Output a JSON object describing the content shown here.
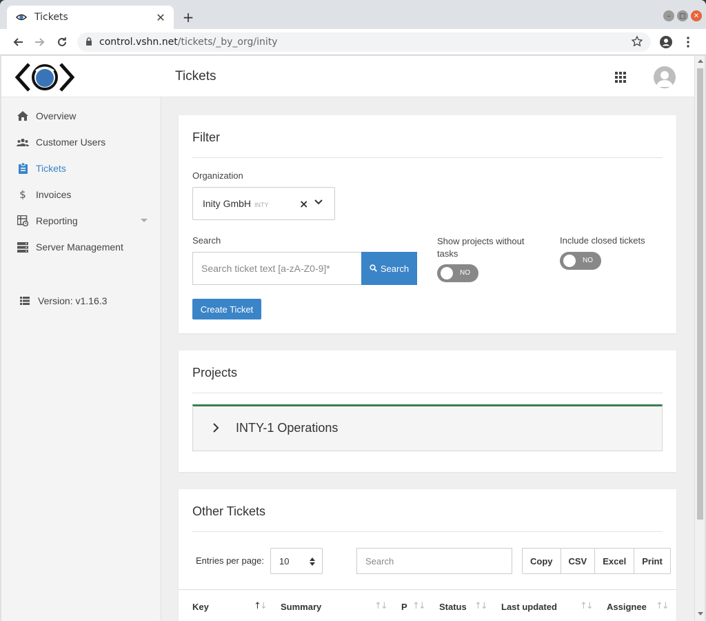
{
  "browser": {
    "tab_title": "Tickets",
    "tab_close": "✕",
    "new_tab": "+",
    "url_host": "control.vshn.net",
    "url_path": "/tickets/_by_org/inity"
  },
  "header": {
    "title": "Tickets"
  },
  "sidebar": {
    "items": [
      {
        "label": "Overview",
        "icon": "home-icon"
      },
      {
        "label": "Customer Users",
        "icon": "users-icon"
      },
      {
        "label": "Tickets",
        "icon": "clipboard-icon"
      },
      {
        "label": "Invoices",
        "icon": "dollar-icon"
      },
      {
        "label": "Reporting",
        "icon": "report-icon"
      },
      {
        "label": "Server Management",
        "icon": "server-icon"
      }
    ],
    "version": "Version: v1.16.3"
  },
  "filter": {
    "title": "Filter",
    "org_label": "Organization",
    "org_value": "Inity GmbH",
    "org_code": "INTY",
    "clear": "×",
    "search_label": "Search",
    "search_placeholder": "Search ticket text [a-zA-Z0-9]*",
    "search_button": "Search",
    "show_projects_label": "Show projects without tasks",
    "show_projects_toggle": "NO",
    "closed_label": "Include closed tickets",
    "closed_toggle": "NO",
    "create_button": "Create Ticket"
  },
  "projects": {
    "title": "Projects",
    "items": [
      {
        "name": "INTY-1 Operations"
      }
    ]
  },
  "other_tickets": {
    "title": "Other Tickets",
    "entries_label": "Entries per page:",
    "entries_value": "10",
    "search_placeholder": "Search",
    "export_buttons": [
      "Copy",
      "CSV",
      "Excel",
      "Print"
    ],
    "columns": [
      "Key",
      "Summary",
      "P",
      "Status",
      "Last updated",
      "Assignee"
    ],
    "sort_up": "↑",
    "sort_down": "↓"
  },
  "colors": {
    "accent": "#3a84c8",
    "project_border": "#3c7d52",
    "toggle_off": "#888888"
  }
}
